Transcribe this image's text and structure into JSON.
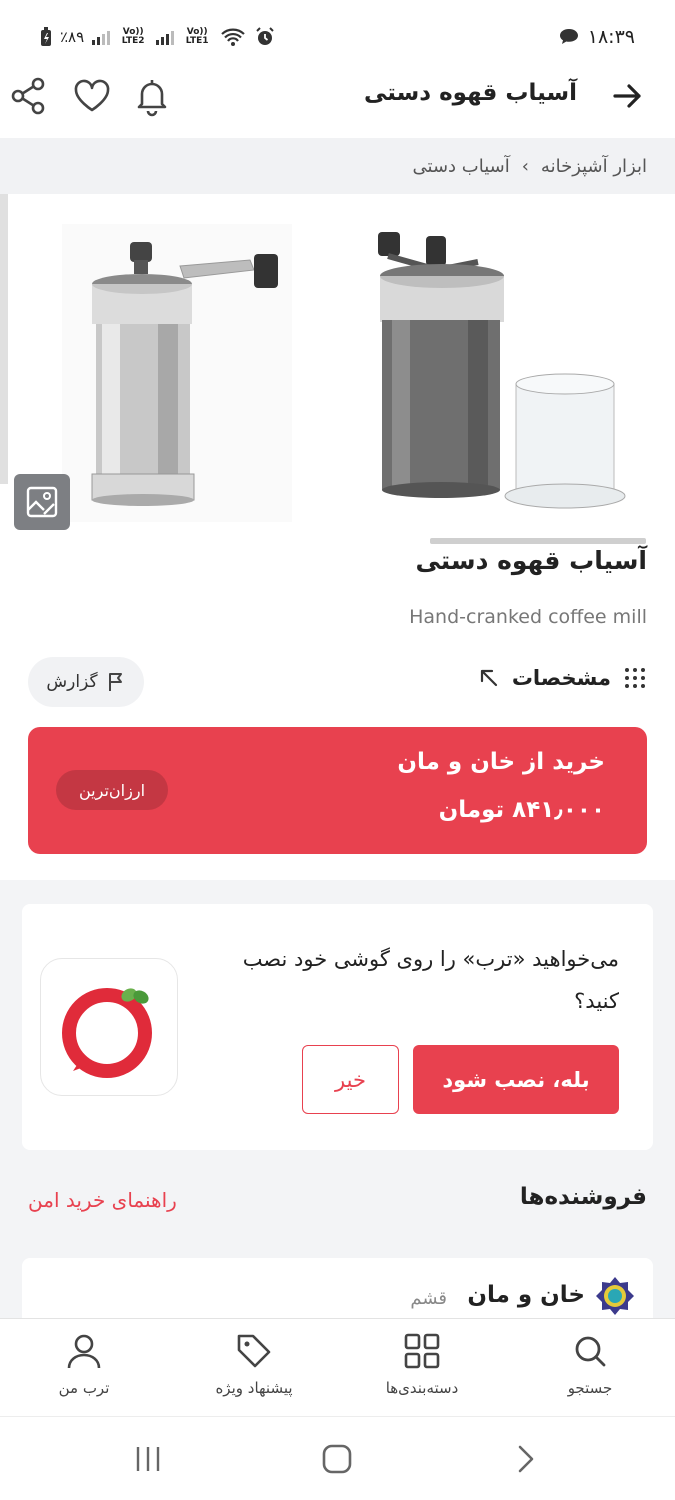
{
  "status_bar": {
    "time": "۱۸:۳۹",
    "battery": "٪۸۹",
    "sim1": "Vo)) LTE2",
    "sim2": "Vo)) LTE1"
  },
  "header": {
    "title": "آسیاب قهوه دستی"
  },
  "breadcrumb": {
    "items": [
      "ابزار آشپزخانه",
      "آسیاب دستی"
    ],
    "separator": "›"
  },
  "product": {
    "title": "آسیاب قهوه دستی",
    "subtitle": "Hand-cranked coffee mill",
    "specs_label": "مشخصات",
    "report_label": "گزارش"
  },
  "buy_box": {
    "line1": "خرید از خان و مان",
    "price": "۸۴۱٫۰۰۰ تومان",
    "badge": "ارزان‌ترین",
    "color": "#e8414f"
  },
  "install_prompt": {
    "question": "می‌خواهید «ترب» را روی گوشی خود نصب کنید؟",
    "yes_label": "بله، نصب شود",
    "no_label": "خیر"
  },
  "sellers": {
    "heading": "فروشنده‌ها",
    "guide_link": "راهنمای خرید امن",
    "first": {
      "name": "خان و مان",
      "city": "قشم"
    }
  },
  "bottom_nav": [
    {
      "label": "جستجو",
      "icon": "search-icon"
    },
    {
      "label": "دسته‌بندی‌ها",
      "icon": "grid-icon"
    },
    {
      "label": "پیشنهاد ویژه",
      "icon": "tag-icon"
    },
    {
      "label": "ترب من",
      "icon": "user-icon"
    }
  ],
  "colors": {
    "accent": "#e8414f",
    "breadcrumb_bg": "#f1f2f4"
  }
}
